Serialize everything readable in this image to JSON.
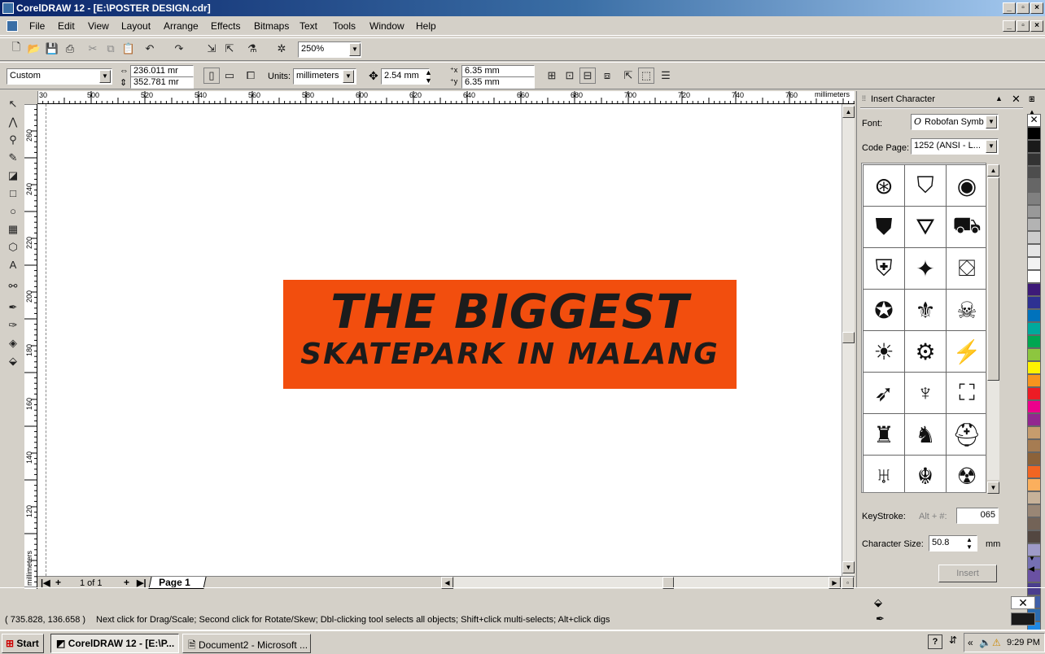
{
  "window": {
    "title": "CorelDRAW 12 - [E:\\POSTER DESIGN.cdr]"
  },
  "menu": [
    "File",
    "Edit",
    "View",
    "Layout",
    "Arrange",
    "Effects",
    "Bitmaps",
    "Text",
    "Tools",
    "Window",
    "Help"
  ],
  "toolbar": {
    "zoom": "250%"
  },
  "propertybar": {
    "page_size": "Custom",
    "width": "236.011 mr",
    "height": "352.781 mr",
    "units_label": "Units:",
    "units": "millimeters",
    "nudge": "2.54 mm",
    "dup_x": "6.35 mm",
    "dup_y": "6.35 mm"
  },
  "ruler": {
    "h_ticks": [
      "30",
      "500",
      "520",
      "540",
      "560",
      "580",
      "600",
      "620",
      "640",
      "660",
      "680",
      "700",
      "720",
      "740",
      "760"
    ],
    "h_unit": "millimeters",
    "v_ticks": [
      "260",
      "240",
      "220",
      "200",
      "180",
      "160",
      "140",
      "120"
    ],
    "v_unit": "millimeters"
  },
  "document": {
    "line1": "THE BIGGEST",
    "line2": "SKATEPARK IN MALANG",
    "banner_color": "#f24e0e"
  },
  "page_nav": {
    "counter": "1 of 1",
    "tab": "Page 1"
  },
  "docker": {
    "title": "Insert Character",
    "font_label": "Font:",
    "font_value": "Robofan Symb",
    "codepage_label": "Code Page:",
    "codepage_value": "1252  (ANSI - L...",
    "keystroke_label": "KeyStroke:",
    "keystroke_hint": "Alt + #:",
    "keystroke_value": "065",
    "size_label": "Character Size:",
    "size_value": "50.8",
    "size_unit": "mm",
    "insert_button": "Insert",
    "glyph_icons": [
      "disc-emblem-icon",
      "robot-head-icon",
      "round-seal-icon",
      "autobot-face-icon",
      "decepticon-face-icon",
      "winged-mask-icon",
      "insignia-mask-icon",
      "lion-face-icon",
      "autobot-icon",
      "decepticon-icon",
      "horned-helmet-icon",
      "skull-visor-icon",
      "sun-burst-icon",
      "cog-beast-icon",
      "claw-mark-icon",
      "jet-emblem-icon",
      "bird-head-icon",
      "wide-mask-icon",
      "knight-helm-icon",
      "warrior-helm-icon",
      "round-helm-icon",
      "horned-skull-icon",
      "cat-mask-icon",
      "spider-mask-icon"
    ]
  },
  "palette": [
    "#ffffff",
    "#000000",
    "#1a1a1a",
    "#333333",
    "#4d4d4d",
    "#666666",
    "#808080",
    "#999999",
    "#b3b3b3",
    "#cccccc",
    "#e6e6e6",
    "#f2f2f2",
    "#ffffff",
    "#3d1a78",
    "#2e3192",
    "#0072bc",
    "#00a99d",
    "#00a651",
    "#8dc63f",
    "#fff200",
    "#f7941d",
    "#ed1c24",
    "#ec008c",
    "#92278f",
    "#c69c6d",
    "#a67c52",
    "#8c6239",
    "#f26522",
    "#fbaf5d",
    "#c7b299",
    "#998675",
    "#736357",
    "#534741",
    "#9e9ac8",
    "#7570b3",
    "#6a51a3",
    "#4a3e8e",
    "#3f5fa8",
    "#2b6cb0",
    "#1e88e5"
  ],
  "status": {
    "coords": "( 735.828, 136.658 )",
    "message": "Next click for Drag/Scale; Second click for Rotate/Skew; Dbl-clicking tool selects all objects; Shift+click multi-selects; Alt+click digs"
  },
  "taskbar": {
    "start": "Start",
    "task1": "CorelDRAW 12 - [E:\\P...",
    "task2": "Document2 - Microsoft ...",
    "time": "9:29 PM"
  }
}
